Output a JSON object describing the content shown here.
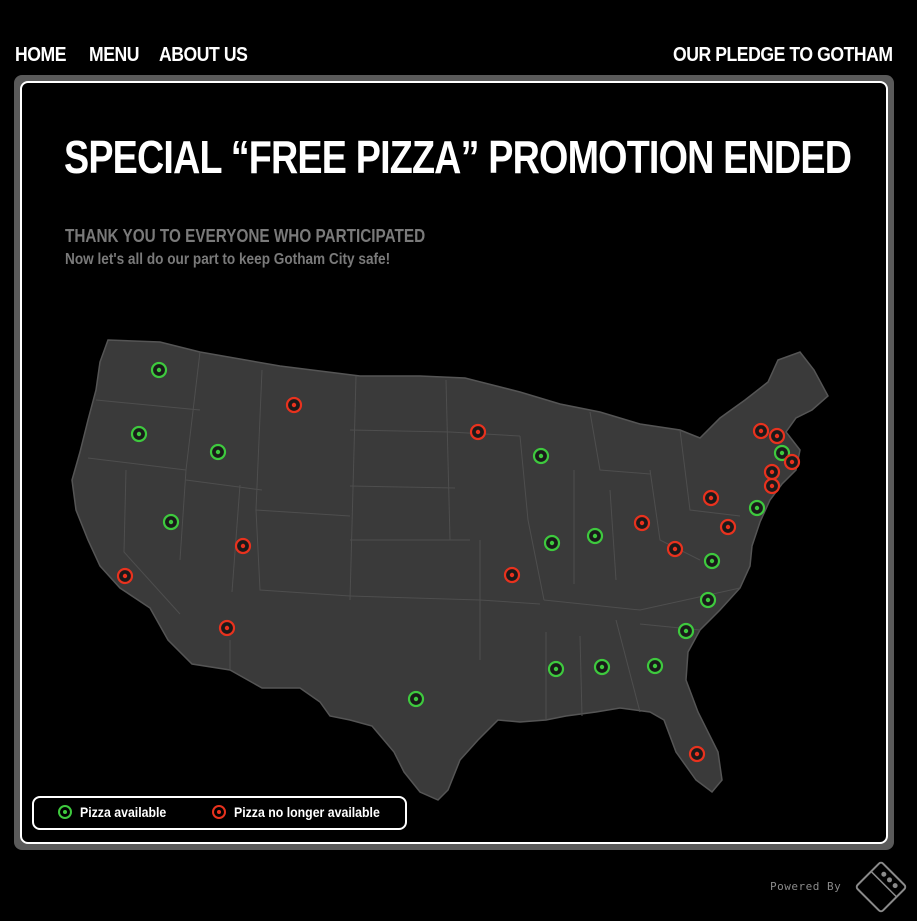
{
  "nav": {
    "home": "HOME",
    "menu": "MENU",
    "about": "ABOUT US",
    "pledge": "OUR PLEDGE TO GOTHAM"
  },
  "main": {
    "headline": "SPECIAL “FREE PIZZA” PROMOTION ENDED",
    "subheading": "THANK YOU TO EVERYONE WHO PARTICIPATED",
    "subtext": "Now let's all do our part to keep Gotham City safe!"
  },
  "legend": {
    "available": "Pizza available",
    "unavailable": "Pizza no longer available"
  },
  "footer": {
    "powered_by": "Powered By",
    "logo_icon": "dominos-pizza-logo-icon"
  },
  "colors": {
    "available": "#3ec93e",
    "unavailable": "#e8321e",
    "map_fill": "#3a3a3a",
    "map_border": "#555555"
  },
  "markers": [
    {
      "region": "WA",
      "status": "available"
    },
    {
      "region": "OR",
      "status": "available"
    },
    {
      "region": "ID",
      "status": "available"
    },
    {
      "region": "NV",
      "status": "available"
    },
    {
      "region": "CA",
      "status": "unavailable"
    },
    {
      "region": "UT",
      "status": "unavailable"
    },
    {
      "region": "AZ",
      "status": "unavailable"
    },
    {
      "region": "MT",
      "status": "unavailable"
    },
    {
      "region": "TX",
      "status": "available"
    },
    {
      "region": "MN",
      "status": "unavailable"
    },
    {
      "region": "WI",
      "status": "available"
    },
    {
      "region": "IL",
      "status": "available"
    },
    {
      "region": "IN",
      "status": "available"
    },
    {
      "region": "MO",
      "status": "unavailable"
    },
    {
      "region": "OH",
      "status": "unavailable"
    },
    {
      "region": "WV",
      "status": "unavailable"
    },
    {
      "region": "PA",
      "status": "unavailable"
    },
    {
      "region": "VA",
      "status": "unavailable"
    },
    {
      "region": "VA-S",
      "status": "available"
    },
    {
      "region": "NC",
      "status": "available"
    },
    {
      "region": "SC",
      "status": "available"
    },
    {
      "region": "GA",
      "status": "available"
    },
    {
      "region": "AL",
      "status": "available"
    },
    {
      "region": "MS",
      "status": "available"
    },
    {
      "region": "FL",
      "status": "unavailable"
    },
    {
      "region": "NY",
      "status": "unavailable"
    },
    {
      "region": "CT",
      "status": "unavailable"
    },
    {
      "region": "MA",
      "status": "available"
    },
    {
      "region": "RI",
      "status": "unavailable"
    },
    {
      "region": "NJ",
      "status": "unavailable"
    },
    {
      "region": "NJ-S",
      "status": "unavailable"
    },
    {
      "region": "DE",
      "status": "available"
    }
  ]
}
